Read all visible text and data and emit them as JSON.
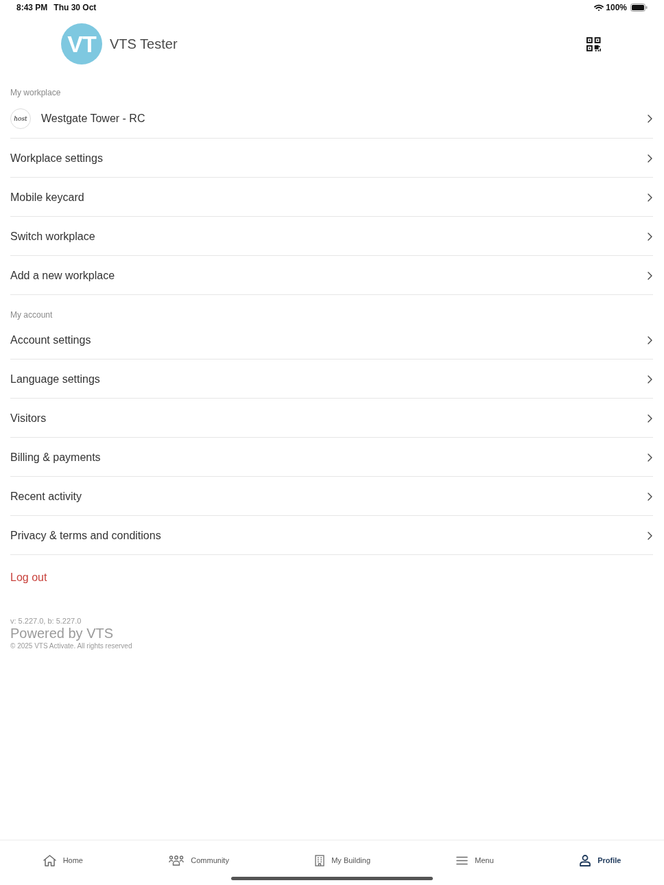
{
  "status_bar": {
    "time": "8:43 PM",
    "date": "Thu 30 Oct",
    "battery": "100%"
  },
  "profile": {
    "initials": "VT",
    "name": "VTS Tester"
  },
  "sections": [
    {
      "title": "My workplace",
      "items": [
        {
          "kind": "workplace",
          "label": "Westgate Tower - RC",
          "logo_text": "host"
        },
        {
          "kind": "link",
          "label": "Workplace settings"
        },
        {
          "kind": "link",
          "label": "Mobile keycard"
        },
        {
          "kind": "link",
          "label": "Switch workplace"
        },
        {
          "kind": "link",
          "label": "Add a new workplace"
        }
      ]
    },
    {
      "title": "My account",
      "items": [
        {
          "kind": "link",
          "label": "Account settings"
        },
        {
          "kind": "link",
          "label": "Language settings"
        },
        {
          "kind": "link",
          "label": "Visitors"
        },
        {
          "kind": "link",
          "label": "Billing & payments"
        },
        {
          "kind": "link",
          "label": "Recent activity"
        },
        {
          "kind": "link",
          "label": "Privacy & terms and conditions"
        }
      ]
    }
  ],
  "logout": "Log out",
  "footer": {
    "version": "v: 5.227.0, b: 5.227.0",
    "powered_by": "Powered by VTS",
    "copyright": "© 2025 VTS Activate. All rights reserved"
  },
  "tab_bar": [
    {
      "kind": "home",
      "label": "Home",
      "selected": false
    },
    {
      "kind": "community",
      "label": "Community",
      "selected": false
    },
    {
      "kind": "building",
      "label": "My Building",
      "selected": false
    },
    {
      "kind": "menu",
      "label": "Menu",
      "selected": false
    },
    {
      "kind": "profile",
      "label": "Profile",
      "selected": true
    }
  ]
}
